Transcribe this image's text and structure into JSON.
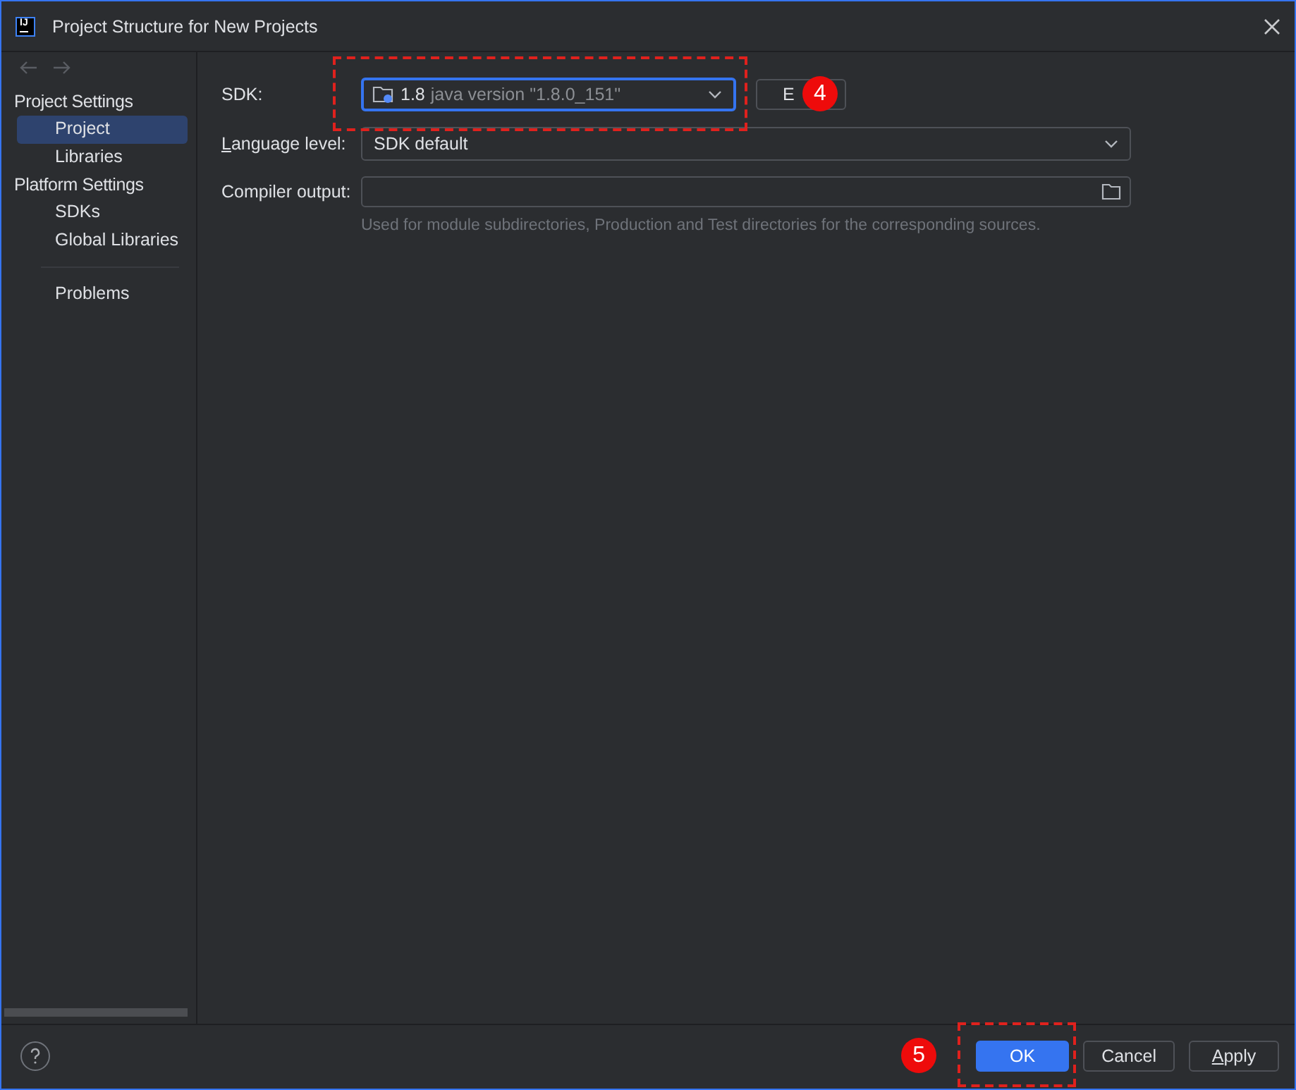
{
  "window": {
    "title": "Project Structure for New Projects",
    "logo": "IJ"
  },
  "sidebar": {
    "groups": [
      {
        "heading": "Project Settings",
        "items": [
          {
            "label": "Project",
            "selected": true
          },
          {
            "label": "Libraries",
            "selected": false
          }
        ]
      },
      {
        "heading": "Platform Settings",
        "items": [
          {
            "label": "SDKs",
            "selected": false
          },
          {
            "label": "Global Libraries",
            "selected": false
          }
        ]
      }
    ],
    "extra_items": [
      {
        "label": "Problems",
        "selected": false
      }
    ]
  },
  "form": {
    "sdk": {
      "label": "SDK:",
      "version": "1.8",
      "detail": "java version \"1.8.0_151\"",
      "focused": true,
      "button": "E"
    },
    "language_level": {
      "label": "Language level:",
      "value": "SDK default"
    },
    "compiler_output": {
      "label": "Compiler output:",
      "hint": "Used for module subdirectories, Production and Test directories for the corresponding sources."
    }
  },
  "annotations": [
    {
      "number": "4"
    },
    {
      "number": "5"
    }
  ],
  "buttons": [
    {
      "label": "OK",
      "kind": "primary"
    },
    {
      "label": "Cancel",
      "kind": "secondary"
    },
    {
      "label": "Apply",
      "kind": "secondary"
    }
  ]
}
